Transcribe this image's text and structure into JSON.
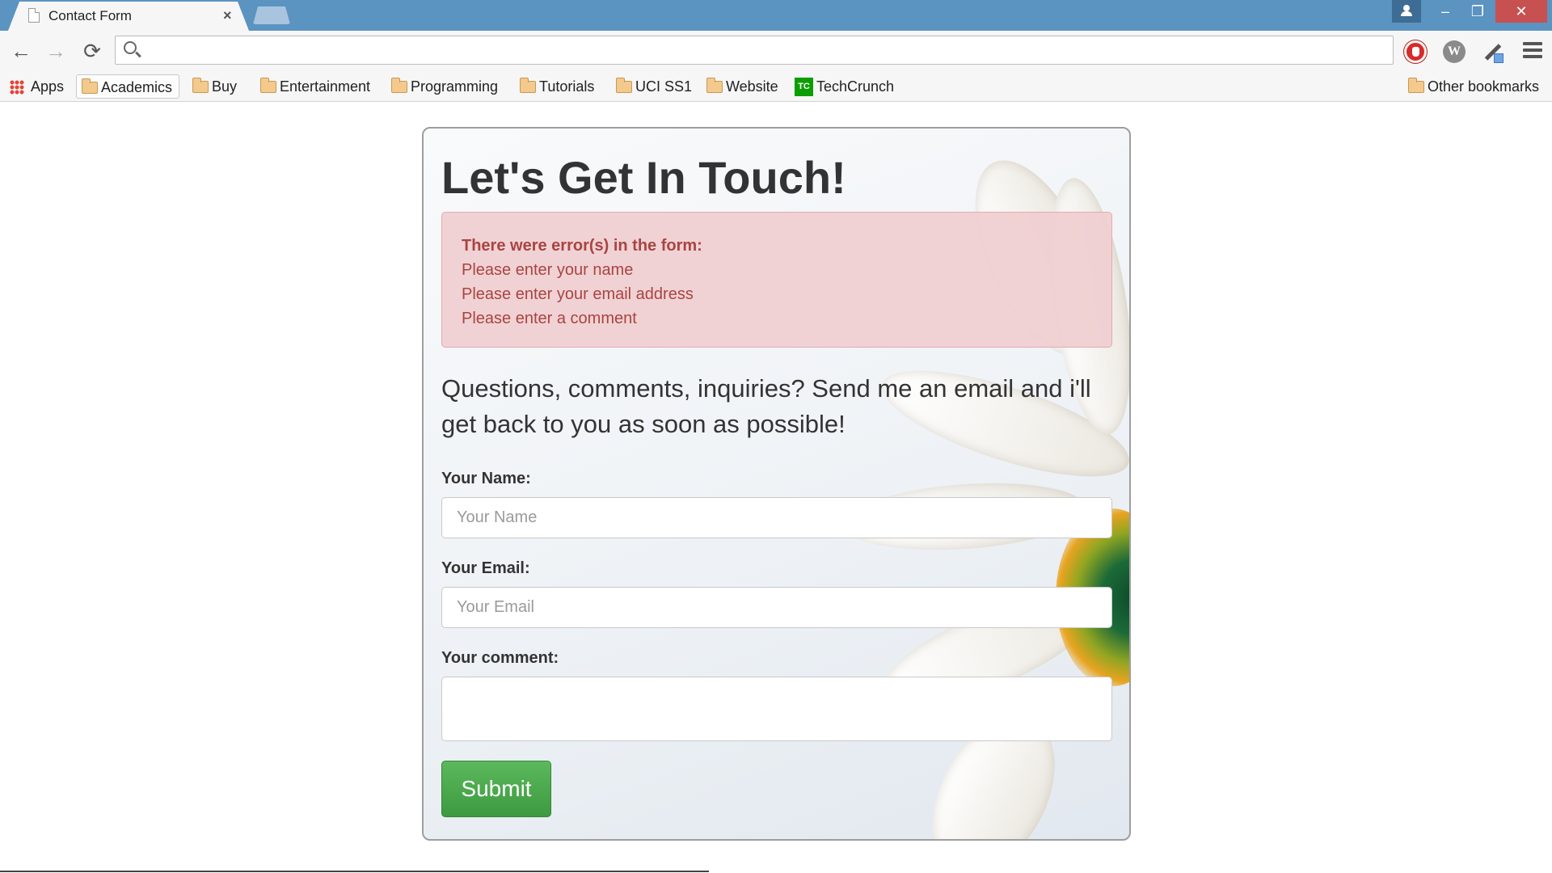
{
  "browser": {
    "tab_title": "Contact Form",
    "tab_close": "×",
    "address_value": "",
    "window": {
      "minimize": "–",
      "maximize": "❐",
      "close": "✕"
    }
  },
  "toolbar": {
    "back_glyph": "←",
    "forward_glyph": "→",
    "reload_glyph": "⟳",
    "extensions": [
      "adblock-icon",
      "w-extension-icon",
      "eyedropper-icon"
    ],
    "w_letter": "W"
  },
  "bookmarks": {
    "apps": "Apps",
    "items": [
      "Academics",
      "Buy",
      "Entertainment",
      "Programming",
      "Tutorials",
      "UCI SS1",
      "Website",
      "TechCrunch"
    ],
    "techcrunch_badge": "TC",
    "other": "Other bookmarks"
  },
  "page": {
    "title": "Let's Get In Touch!",
    "errors": {
      "heading": "There were error(s) in the form:",
      "messages": [
        "Please enter your name",
        "Please enter your email address",
        "Please enter a comment"
      ]
    },
    "intro": "Questions, comments, inquiries? Send me an email and i'll get back to you as soon as possible!",
    "form": {
      "name_label": "Your Name:",
      "name_placeholder": "Your Name",
      "name_value": "",
      "email_label": "Your Email:",
      "email_placeholder": "Your Email",
      "email_value": "",
      "comment_label": "Your comment:",
      "comment_value": "",
      "submit_label": "Submit"
    }
  },
  "colors": {
    "titlebar": "#5b93c1",
    "error_text": "#a94442",
    "error_bg": "#f2dede",
    "submit_green": "#4cae4c"
  }
}
